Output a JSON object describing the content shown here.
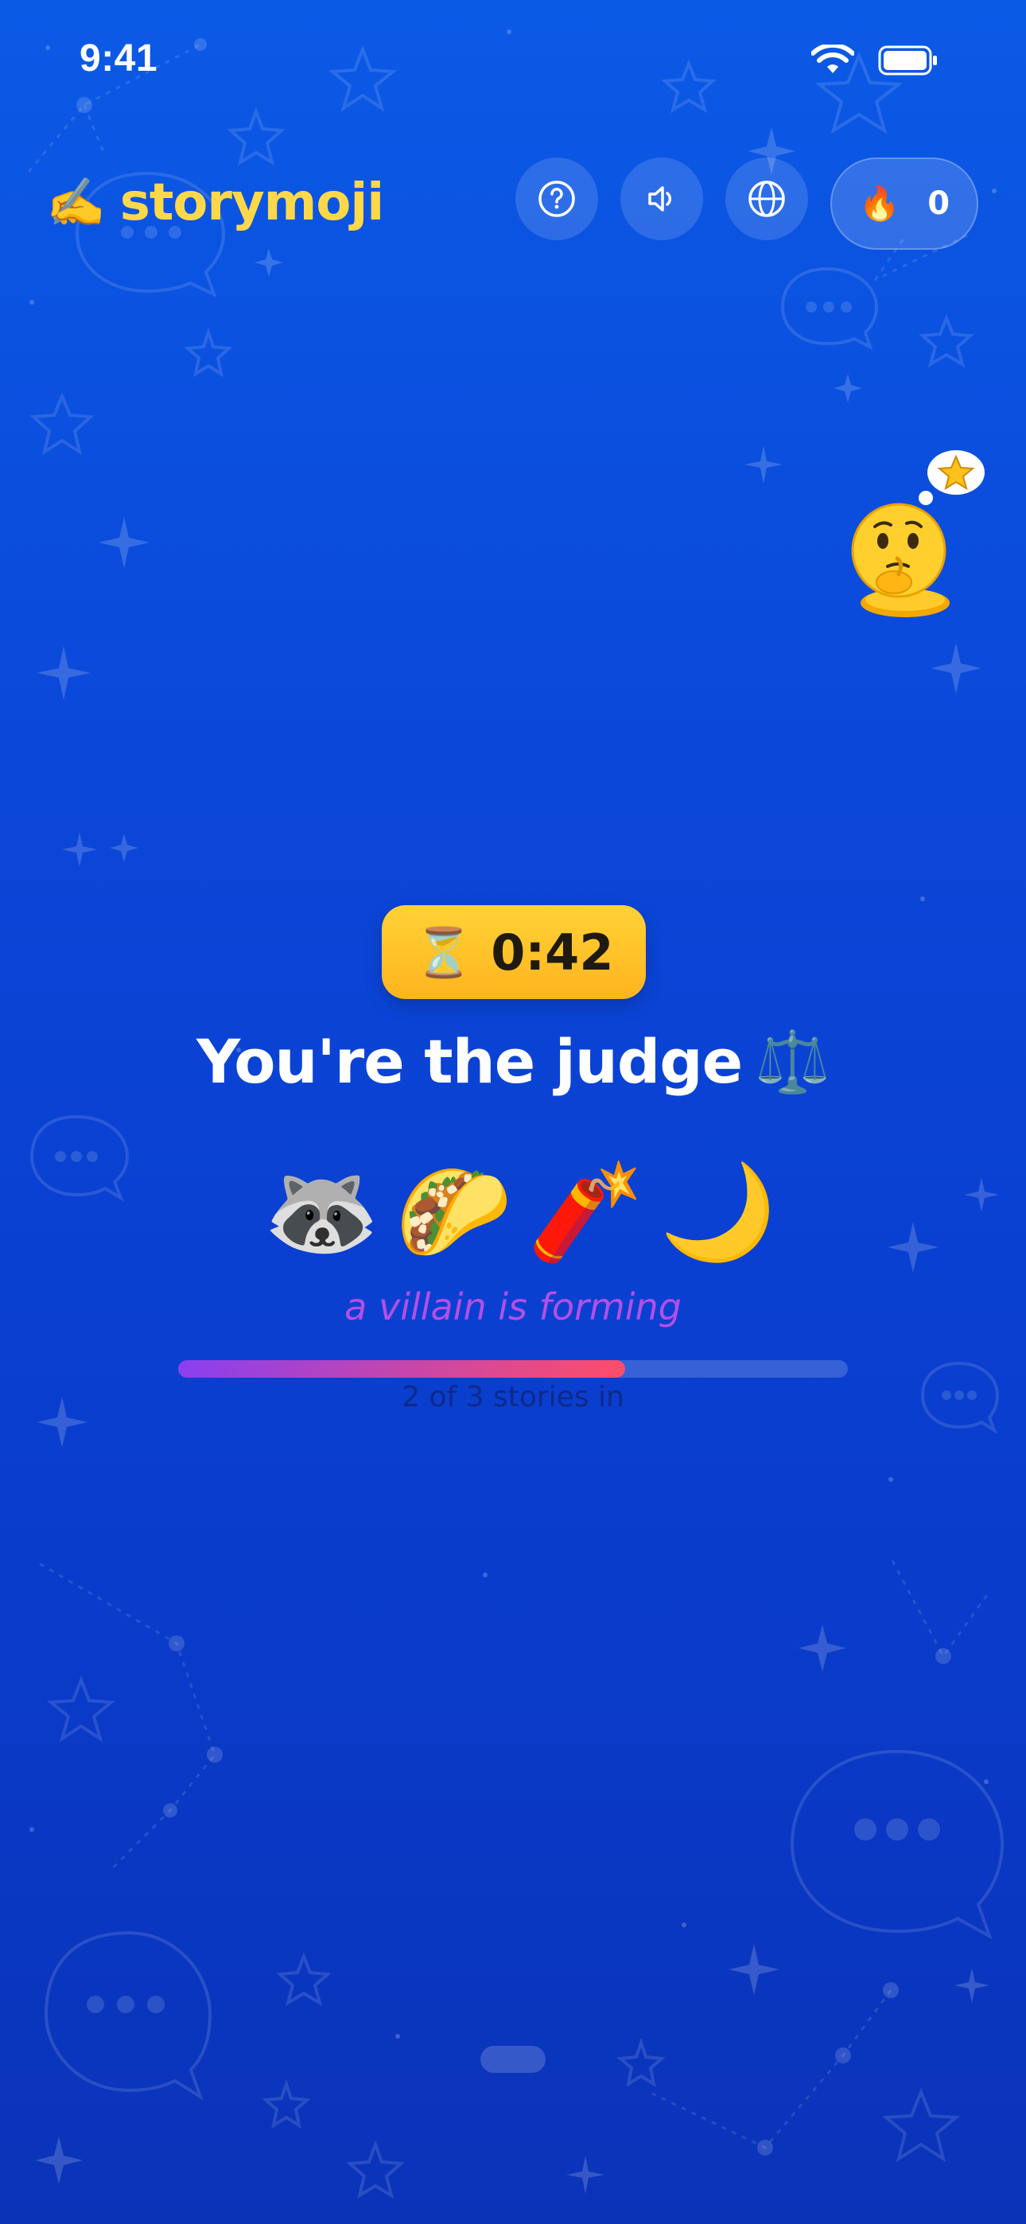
{
  "status_bar": {
    "time": "9:41"
  },
  "header": {
    "logo_emoji": "✍️",
    "logo_text": "storymoji",
    "buttons": [
      {
        "name": "help",
        "icon": "question-circle-icon"
      },
      {
        "name": "sound",
        "icon": "speaker-icon"
      },
      {
        "name": "language",
        "icon": "globe-icon"
      }
    ],
    "streak": {
      "icon": "🔥",
      "count": "0"
    }
  },
  "mascot": {
    "icon": "thinking-face-with-star-bubble"
  },
  "game": {
    "timer_icon": "⏳",
    "timer": "0:42",
    "title": "You're the judge",
    "title_emoji": "⚖️",
    "emojis": [
      "🦝",
      "🌮",
      "🧨",
      "🌙"
    ],
    "hint": "a villain is forming",
    "progress": {
      "current": 2,
      "total": 3,
      "fraction": 0.667
    },
    "progress_label": "2 of 3 stories in"
  },
  "colors": {
    "background_top": "#0b5ae6",
    "background_bottom": "#0a33b8",
    "accent_yellow": "#ffd84a",
    "timer_bg": "#ffc12a",
    "hint_color": "#b34fe6",
    "progress_start": "#8a3ff0",
    "progress_end": "#ff4d6a"
  }
}
